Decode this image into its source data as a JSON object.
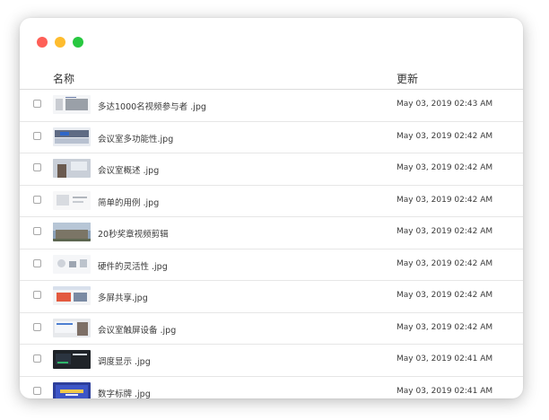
{
  "window": {
    "controls": [
      "close",
      "minimize",
      "maximize"
    ]
  },
  "header": {
    "name_label": "名称",
    "updated_label": "更新"
  },
  "files": [
    {
      "name": "多达1000名视频参与者 .jpg",
      "updated": "May 03, 2019 02:43 AM",
      "thumb": "t-slide"
    },
    {
      "name": "会议室多功能性.jpg",
      "updated": "May 03, 2019 02:42 AM",
      "thumb": "t-room"
    },
    {
      "name": "会议室概述 .jpg",
      "updated": "May 03, 2019 02:42 AM",
      "thumb": "t-meet"
    },
    {
      "name": "简单的用例 .jpg",
      "updated": "May 03, 2019 02:42 AM",
      "thumb": "t-light"
    },
    {
      "name": "20秒奖章视频剪辑",
      "updated": "May 03, 2019 02:42 AM",
      "thumb": "t-building"
    },
    {
      "name": "硬件的灵活性 .jpg",
      "updated": "May 03, 2019 02:42 AM",
      "thumb": "t-devices"
    },
    {
      "name": "多屏共享.jpg",
      "updated": "May 03, 2019 02:42 AM",
      "thumb": "t-screens"
    },
    {
      "name": "会议室触屏设备 .jpg",
      "updated": "May 03, 2019 02:42 AM",
      "thumb": "t-touch"
    },
    {
      "name": "调度显示 .jpg",
      "updated": "May 03, 2019 02:41 AM",
      "thumb": "t-dark"
    },
    {
      "name": "数字标牌 .jpg",
      "updated": "May 03, 2019 02:41 AM",
      "thumb": "t-sign"
    }
  ],
  "colors": {
    "close": "#fe5f57",
    "minimize": "#febc2e",
    "maximize": "#28c840"
  }
}
